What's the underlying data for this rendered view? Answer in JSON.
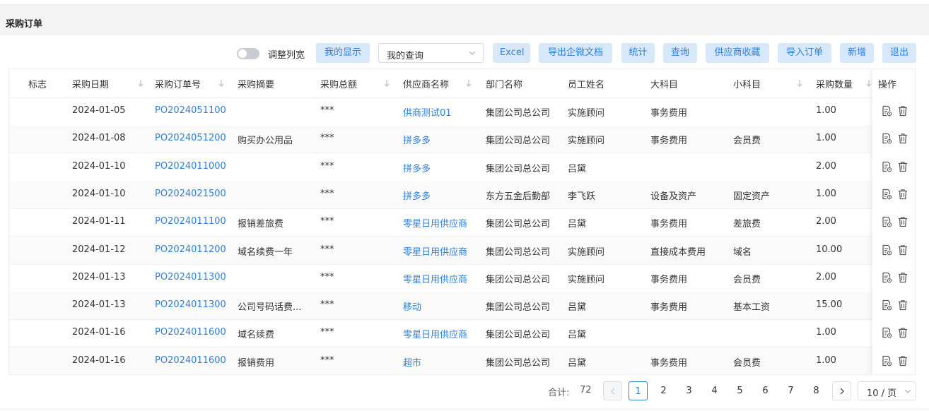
{
  "page": {
    "title": "采购订单"
  },
  "toolbar": {
    "toggle_label": "调整列宽",
    "my_display": "我的显示",
    "my_query": "我的查询",
    "excel": "Excel",
    "export_wecom": "导出企微文档",
    "stats": "统计",
    "query": "查询",
    "supplier_fav": "供应商收藏",
    "import_order": "导入订单",
    "add": "新增",
    "exit": "退出"
  },
  "table": {
    "headers": [
      "标志",
      "采购日期",
      "采购订单号",
      "采购摘要",
      "采购总额",
      "供应商名称",
      "部门名称",
      "员工姓名",
      "大科目",
      "小科目",
      "采购数量",
      "操作"
    ],
    "rows": [
      [
        "",
        "2024-01-05",
        "PO2024051100",
        "",
        "***",
        "供商测试01",
        "集团公司总公司",
        "实施顾问",
        "事务费用",
        "",
        "1.00"
      ],
      [
        "",
        "2024-01-08",
        "PO2024051200",
        "购买办公用品",
        "***",
        "拼多多",
        "集团公司总公司",
        "实施顾问",
        "事务费用",
        "会员费",
        "1.00"
      ],
      [
        "",
        "2024-01-10",
        "PO2024011000",
        "",
        "***",
        "拼多多",
        "集团公司总公司",
        "吕黛",
        "",
        "",
        "2.00"
      ],
      [
        "",
        "2024-01-10",
        "PO2024021500",
        "",
        "***",
        "拼多多",
        "东方五金后勤部",
        "李飞跃",
        "设备及资产",
        "固定资产",
        "1.00"
      ],
      [
        "",
        "2024-01-11",
        "PO2024011100",
        "报销差旅费",
        "***",
        "零星日用供应商",
        "集团公司总公司",
        "吕黛",
        "事务费用",
        "差旅费",
        "2.00"
      ],
      [
        "",
        "2024-01-12",
        "PO2024011200",
        "域名续费一年",
        "***",
        "零星日用供应商",
        "集团公司总公司",
        "实施顾问",
        "直接成本费用",
        "域名",
        "10.00"
      ],
      [
        "",
        "2024-01-13",
        "PO2024011300",
        "",
        "***",
        "零星日用供应商",
        "集团公司总公司",
        "实施顾问",
        "事务费用",
        "会员费",
        "2.00"
      ],
      [
        "",
        "2024-01-13",
        "PO2024011300",
        "公司号码话费...",
        "***",
        "移动",
        "集团公司总公司",
        "吕黛",
        "事务费用",
        "基本工资",
        "15.00"
      ],
      [
        "",
        "2024-01-16",
        "PO2024011600",
        "域名续费",
        "***",
        "零星日用供应商",
        "集团公司总公司",
        "吕黛",
        "",
        "",
        "1.00"
      ],
      [
        "",
        "2024-01-16",
        "PO2024011600",
        "报销费用",
        "***",
        "超市",
        "集团公司总公司",
        "吕黛",
        "事务费用",
        "会员费",
        "1.00"
      ]
    ]
  },
  "pagination": {
    "total_label": "合计:",
    "total": "72",
    "pages": [
      "1",
      "2",
      "3",
      "4",
      "5",
      "6",
      "7",
      "8"
    ],
    "current": "1",
    "page_size": "10 / 页"
  },
  "colors": {
    "accent": "#2f7fdc",
    "button_bg": "#d8e8fb"
  },
  "icons": {
    "row_edit": "document-edit-icon",
    "row_delete": "trash-icon"
  }
}
